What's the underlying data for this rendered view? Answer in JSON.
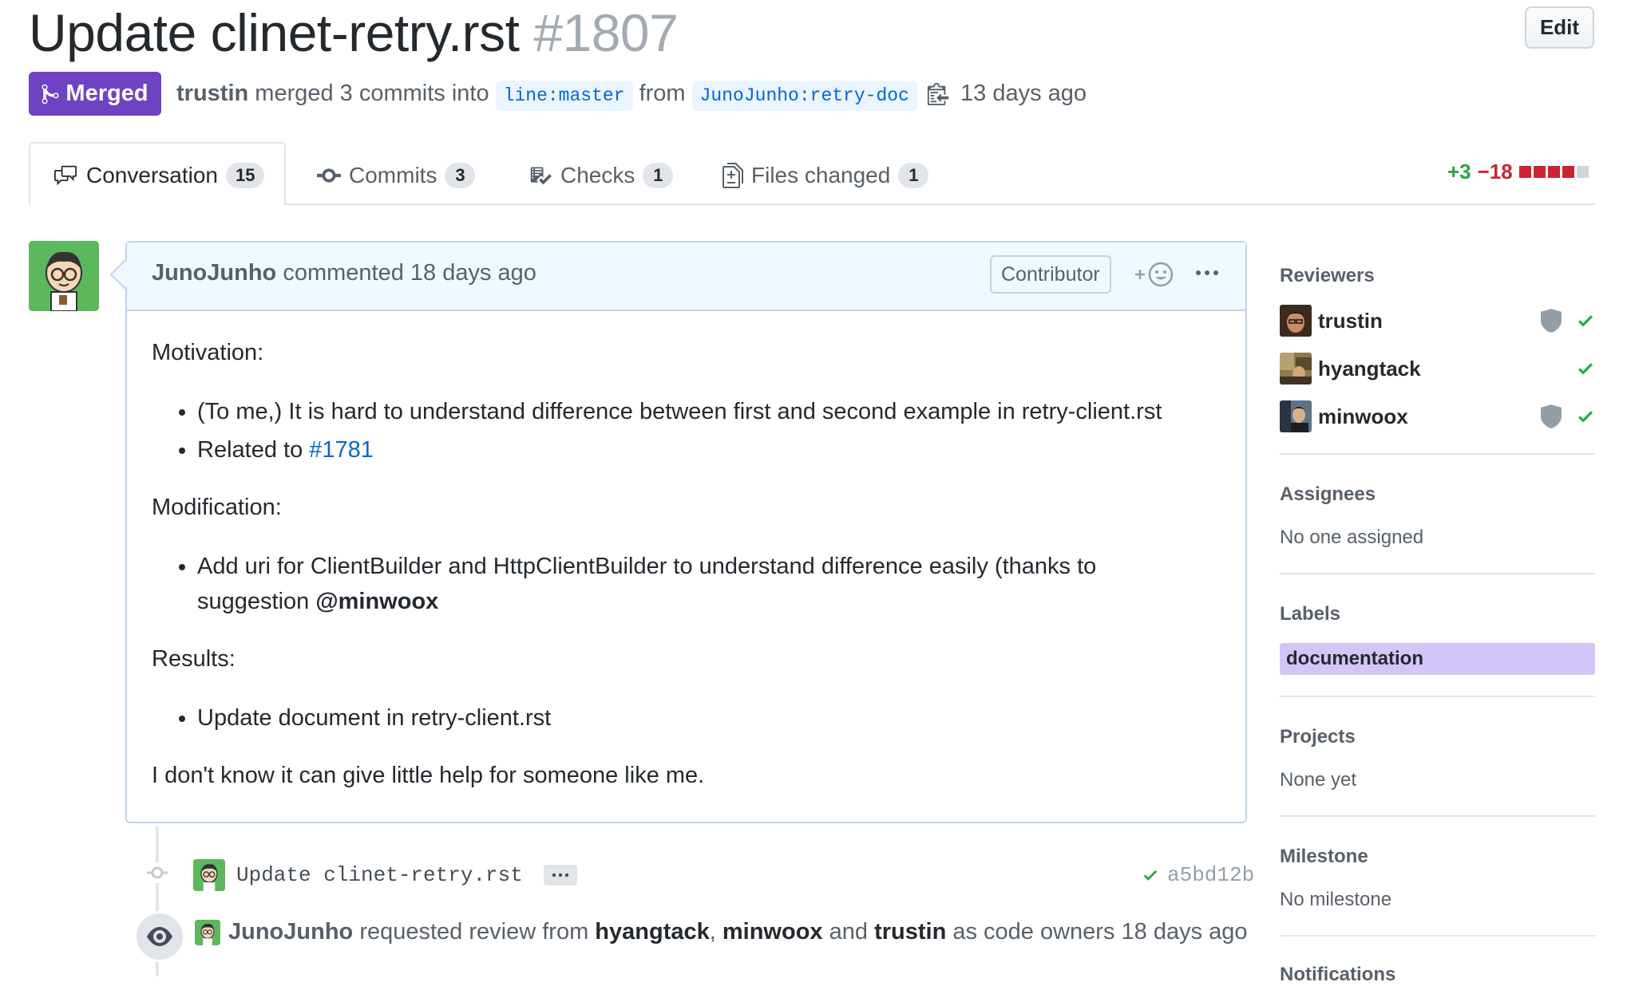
{
  "pr": {
    "title": "Update clinet-retry.rst",
    "number": "#1807",
    "edit_label": "Edit",
    "state_label": "Merged",
    "merger": "trustin",
    "merge_text": "merged 3 commits into",
    "base_branch": "line:master",
    "from_text": "from",
    "head_branch": "JunoJunho:retry-doc",
    "merged_ago": "13 days ago"
  },
  "tabs": [
    {
      "label": "Conversation",
      "count": "15",
      "icon": "comment-discussion-icon"
    },
    {
      "label": "Commits",
      "count": "3",
      "icon": "git-commit-icon"
    },
    {
      "label": "Checks",
      "count": "1",
      "icon": "checklist-icon"
    },
    {
      "label": "Files changed",
      "count": "1",
      "icon": "file-diff-icon"
    }
  ],
  "diffstat": {
    "additions": "+3",
    "deletions": "−18"
  },
  "comment": {
    "author": "JunoJunho",
    "action": "commented 18 days ago",
    "role_badge": "Contributor",
    "motivation_heading": "Motivation:",
    "motivation_item_1": "(To me,) It is hard to understand difference between first and second example in retry-client.rst",
    "motivation_item_2_prefix": "Related to",
    "motivation_item_2_link": "#1781",
    "modification_heading": "Modification:",
    "modification_item_1": "Add uri for ClientBuilder and HttpClientBuilder to understand difference easily (thanks to suggestion",
    "modification_mention": "@minwoox",
    "results_heading": "Results:",
    "results_item_1": "Update document in retry-client.rst",
    "closing": "I don't know it can give little help for someone like me."
  },
  "timeline": {
    "commit_message": "Update clinet-retry.rst",
    "commit_sha": "a5bd12b",
    "review_author": "JunoJunho",
    "review_text_1": "requested review from",
    "reviewer_1": "hyangtack",
    "reviewer_2": "minwoox",
    "review_and": "and",
    "reviewer_3": "trustin",
    "review_text_2": "as code owners 18 days ago"
  },
  "sidebar": {
    "reviewers_heading": "Reviewers",
    "reviewers": [
      {
        "name": "trustin",
        "code_owner": true,
        "approved": true
      },
      {
        "name": "hyangtack",
        "code_owner": false,
        "approved": true
      },
      {
        "name": "minwoox",
        "code_owner": true,
        "approved": true
      }
    ],
    "assignees_heading": "Assignees",
    "assignees_value": "No one assigned",
    "labels_heading": "Labels",
    "label": "documentation",
    "projects_heading": "Projects",
    "projects_value": "None yet",
    "milestone_heading": "Milestone",
    "milestone_value": "No milestone",
    "notifications_heading": "Notifications"
  },
  "colors": {
    "merged": "#6f42c1",
    "link": "#0366d6",
    "success": "#28a745",
    "danger": "#cb2431",
    "label_bg": "#d4c5f9"
  }
}
